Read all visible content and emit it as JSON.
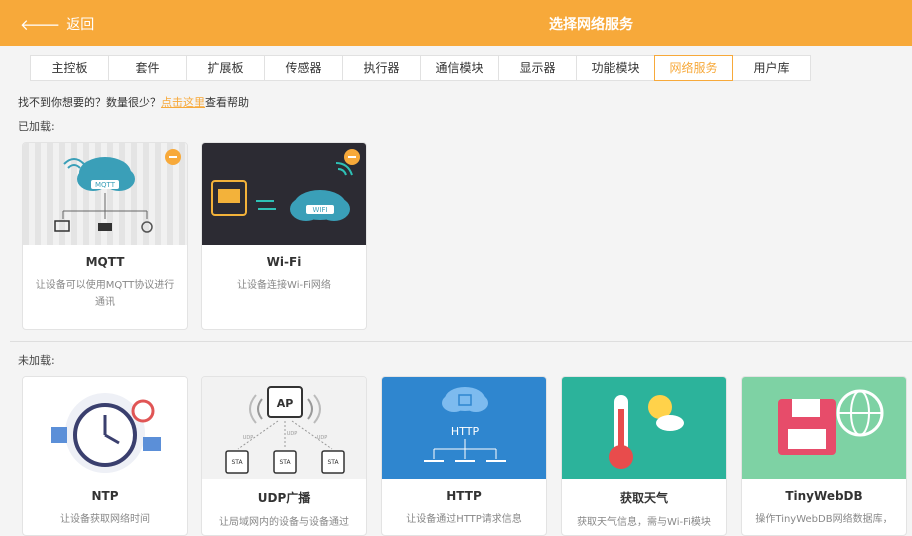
{
  "header": {
    "back_label": "返回",
    "title": "选择网络服务"
  },
  "tabs": [
    {
      "label": "主控板"
    },
    {
      "label": "套件"
    },
    {
      "label": "扩展板"
    },
    {
      "label": "传感器"
    },
    {
      "label": "执行器"
    },
    {
      "label": "通信模块"
    },
    {
      "label": "显示器"
    },
    {
      "label": "功能模块"
    },
    {
      "label": "网络服务"
    },
    {
      "label": "用户库"
    }
  ],
  "active_tab": "网络服务",
  "help": {
    "prefix": "找不到你想要的？数量很少？",
    "link": "点击这里",
    "suffix": "查看帮助"
  },
  "loaded": {
    "label": "已加载:",
    "cards": [
      {
        "name": "MQTT",
        "desc": "让设备可以使用MQTT协议进行通讯",
        "badge": "MQTT"
      },
      {
        "name": "Wi-Fi",
        "desc": "让设备连接Wi-Fi网络",
        "badge": "WIFI"
      }
    ]
  },
  "unloaded": {
    "label": "未加载:",
    "cards": [
      {
        "name": "NTP",
        "desc": "让设备获取网络时间"
      },
      {
        "name": "UDP广播",
        "desc": "让局域网内的设备与设备通过",
        "badge": "AP",
        "node_labels": [
          "STA",
          "STA",
          "STA"
        ],
        "udp_labels": [
          "UDP",
          "UDP",
          "UDP"
        ]
      },
      {
        "name": "HTTP",
        "desc": "让设备通过HTTP请求信息",
        "badge": "HTTP"
      },
      {
        "name": "获取天气",
        "desc": "获取天气信息，需与Wi-Fi模块"
      },
      {
        "name": "TinyWebDB",
        "desc": "操作TinyWebDB网络数据库，"
      }
    ]
  },
  "colors": {
    "accent": "#f7a93a",
    "mqtt_bg": "#e9e9e9",
    "wifi_bg": "#2c2b33",
    "http_bg": "#2f86cf",
    "weather_bg": "#2cb39b",
    "tinywebdb_bg": "#7ed2a4"
  }
}
